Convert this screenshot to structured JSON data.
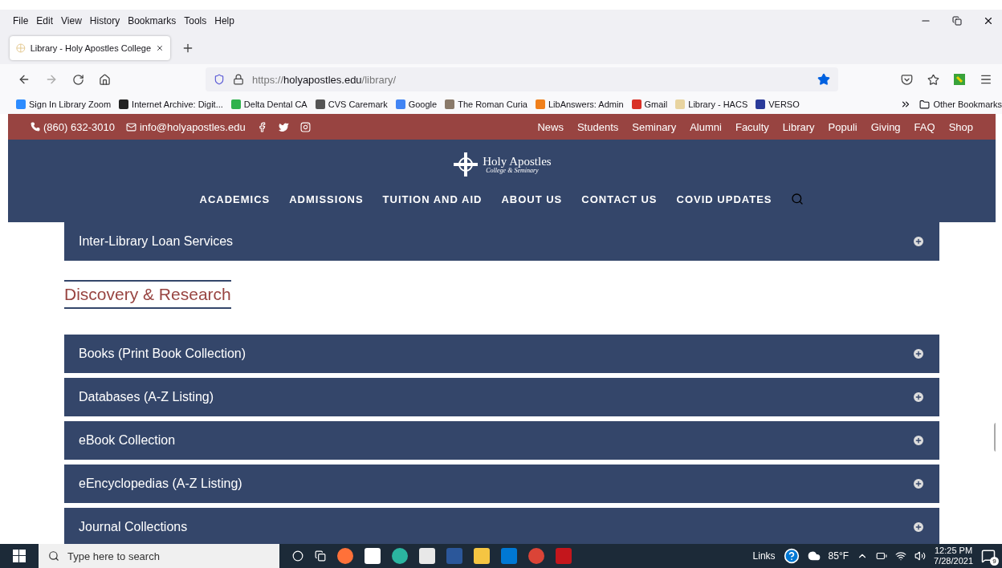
{
  "menu_bar": [
    "File",
    "Edit",
    "View",
    "History",
    "Bookmarks",
    "Tools",
    "Help"
  ],
  "tabs": [
    {
      "label": "Library - Holy Apostles College",
      "selected": true
    }
  ],
  "address_bar": {
    "scheme": "https://",
    "host": "holyapostles.edu",
    "path": "/library/",
    "bookmarked": true
  },
  "bookmarks": [
    {
      "label": "Sign In Library Zoom",
      "color": "#2d8cff"
    },
    {
      "label": "Internet Archive: Digit...",
      "color": "#222222"
    },
    {
      "label": "Delta Dental CA",
      "color": "#2fb24c"
    },
    {
      "label": "CVS Caremark",
      "color": "#555555"
    },
    {
      "label": "Google",
      "color": "#4285f4"
    },
    {
      "label": "The Roman Curia",
      "color": "#8a7a6a"
    },
    {
      "label": "LibAnswers: Admin",
      "color": "#f07f1a"
    },
    {
      "label": "Gmail",
      "color": "#d93025"
    },
    {
      "label": "Library - HACS",
      "color": "#e8d4a0"
    },
    {
      "label": "VERSO",
      "color": "#2a3a9a"
    }
  ],
  "other_bookmarks": "Other Bookmarks",
  "site": {
    "phone": "(860) 632-3010",
    "email": "info@holyapostles.edu",
    "top_links": [
      "News",
      "Students",
      "Seminary",
      "Alumni",
      "Faculty",
      "Library",
      "Populi",
      "Giving",
      "FAQ",
      "Shop"
    ],
    "logo": {
      "name": "Holy Apostles",
      "tagline": "College & Seminary"
    },
    "main_nav": [
      "ACADEMICS",
      "ADMISSIONS",
      "TUITION AND AID",
      "ABOUT US",
      "CONTACT US",
      "COVID UPDATES"
    ]
  },
  "sections": [
    {
      "kind": "accordion",
      "items": [
        {
          "title": "Inter-Library Loan Services",
          "expanded": false
        }
      ]
    },
    {
      "kind": "heading",
      "title": "Discovery & Research"
    },
    {
      "kind": "accordion",
      "items": [
        {
          "title": "Books (Print Book Collection)",
          "expanded": false
        },
        {
          "title": "Databases (A-Z Listing)",
          "expanded": false
        },
        {
          "title": "eBook Collection",
          "expanded": false
        },
        {
          "title": "eEncyclopedias (A-Z Listing)",
          "expanded": false
        },
        {
          "title": "Journal Collections",
          "expanded": false
        }
      ]
    }
  ],
  "taskbar": {
    "search_placeholder": "Type here to search",
    "links": "Links",
    "weather": "85°F",
    "time": "12:25 PM",
    "date": "7/28/2021",
    "notifications": "9"
  }
}
